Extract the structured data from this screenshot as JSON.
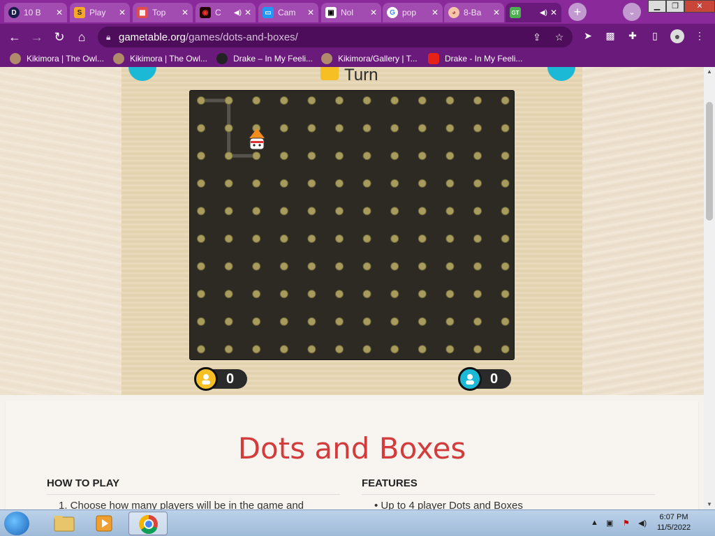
{
  "tabs": [
    {
      "title": "10 B",
      "icon": "d-logo-icon",
      "color": "#1a1a4a",
      "letter": "D"
    },
    {
      "title": "Play",
      "icon": "s-logo-icon",
      "color": "#f7a826",
      "letter": "S"
    },
    {
      "title": "Top",
      "icon": "game-controller-icon",
      "color": "#e04c4c",
      "letter": ""
    },
    {
      "title": "C",
      "icon": "red-eye-icon",
      "color": "#220000",
      "letter": ""
    },
    {
      "title": "Cam",
      "icon": "screen-icon",
      "color": "#2196f3",
      "letter": ""
    },
    {
      "title": "Nol",
      "icon": "notion-icon",
      "color": "#ffffff",
      "letter": ""
    },
    {
      "title": "pop",
      "icon": "google-icon",
      "color": "#ffffff",
      "letter": "G"
    },
    {
      "title": "8-Ba",
      "icon": "pig-icon",
      "color": "#f5c5a8",
      "letter": ""
    },
    {
      "title": "",
      "icon": "gametable-icon",
      "color": "#4caf50",
      "letter": "GT"
    }
  ],
  "browser": {
    "url_host": "gametable.org",
    "url_path": "/games/dots-and-boxes/"
  },
  "bookmarks": [
    {
      "label": "Kikimora | The Owl...",
      "icon": "owl-icon"
    },
    {
      "label": "Kikimora | The Owl...",
      "icon": "owl-icon"
    },
    {
      "label": "Drake – In My Feeli...",
      "icon": "drake-icon"
    },
    {
      "label": "Kikimora/Gallery | T...",
      "icon": "owl-icon"
    },
    {
      "label": "Drake - In My Feeli...",
      "icon": "youtube-icon"
    }
  ],
  "game": {
    "turn_label": "Turn",
    "grid_cols": 12,
    "grid_rows": 10,
    "drawn_lines": [
      {
        "from": [
          0,
          0
        ],
        "to": [
          1,
          0
        ]
      },
      {
        "from": [
          1,
          0
        ],
        "to": [
          1,
          1
        ]
      },
      {
        "from": [
          1,
          1
        ],
        "to": [
          1,
          2
        ]
      },
      {
        "from": [
          1,
          2
        ],
        "to": [
          2,
          2
        ]
      }
    ],
    "players": [
      {
        "name": "player-yellow",
        "score": "0",
        "color": "#f6bf23"
      },
      {
        "name": "player-cyan",
        "score": "0",
        "color": "#1cb9d6"
      }
    ]
  },
  "page": {
    "title": "Dots and Boxes",
    "how_to_play_heading": "HOW TO PLAY",
    "how_to_play_first": "1.      Choose how many players will be in the game and",
    "features_heading": "FEATURES",
    "features_first": "•      Up to 4 player Dots and Boxes"
  },
  "taskbar": {
    "time": "6:07 PM",
    "date": "11/5/2022"
  }
}
